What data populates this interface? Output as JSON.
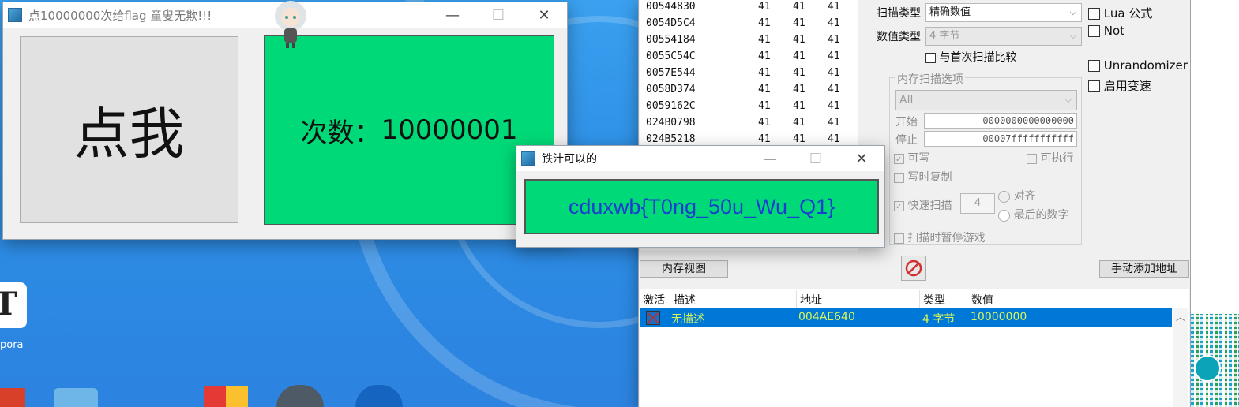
{
  "game_window": {
    "title": "点10000000次给flag 童叟无欺!!!",
    "click_button_label": "点我",
    "count_label": "次数：",
    "count_value": "10000001"
  },
  "flag_dialog": {
    "title": "铁汁可以的",
    "flag_text": "cduxwb{T0ng_50u_Wu_Q1}"
  },
  "scan_results": [
    {
      "address": "00544830",
      "v1": "41",
      "v2": "41",
      "v3": "41"
    },
    {
      "address": "0054D5C4",
      "v1": "41",
      "v2": "41",
      "v3": "41"
    },
    {
      "address": "00554184",
      "v1": "41",
      "v2": "41",
      "v3": "41"
    },
    {
      "address": "0055C54C",
      "v1": "41",
      "v2": "41",
      "v3": "41"
    },
    {
      "address": "0057E544",
      "v1": "41",
      "v2": "41",
      "v3": "41"
    },
    {
      "address": "0058D374",
      "v1": "41",
      "v2": "41",
      "v3": "41"
    },
    {
      "address": "0059162C",
      "v1": "41",
      "v2": "41",
      "v3": "41"
    },
    {
      "address": "024B0798",
      "v1": "41",
      "v2": "41",
      "v3": "41"
    },
    {
      "address": "024B5218",
      "v1": "41",
      "v2": "41",
      "v3": "41"
    }
  ],
  "scan_options": {
    "scan_type_label": "扫描类型",
    "scan_type_value": "精确数值",
    "value_type_label": "数值类型",
    "value_type_value": "4 字节",
    "compare_first_label": "与首次扫描比较",
    "lua_label": "Lua 公式",
    "not_label": "Not",
    "unrandomizer_label": "Unrandomizer",
    "speedhack_label": "启用变速",
    "memory_options_label": "内存扫描选项",
    "region_value": "All",
    "start_label": "开始",
    "start_value": "0000000000000000",
    "stop_label": "停止",
    "stop_value": "00007fffffffffff",
    "writable_label": "可写",
    "executable_label": "可执行",
    "copy_on_write_label": "写时复制",
    "fast_scan_label": "快速扫描",
    "fast_scan_value": "4",
    "align_label": "对齐",
    "last_digits_label": "最后的数字",
    "pause_game_label": "扫描时暂停游戏"
  },
  "toolbar": {
    "memory_view_label": "内存视图",
    "add_address_label": "手动添加地址"
  },
  "address_list": {
    "headers": {
      "active": "激活",
      "description": "描述",
      "address": "地址",
      "type": "类型",
      "value": "数值"
    },
    "rows": [
      {
        "description": "无描述",
        "address": "004AE640",
        "type": "4 字节",
        "value": "10000000"
      }
    ]
  },
  "desktop": {
    "icon_label": "pora"
  },
  "colors": {
    "game_green": "#00d977",
    "flag_text": "#1a3fd0",
    "selection": "#0078d7",
    "selection_text": "#d8f55a"
  }
}
